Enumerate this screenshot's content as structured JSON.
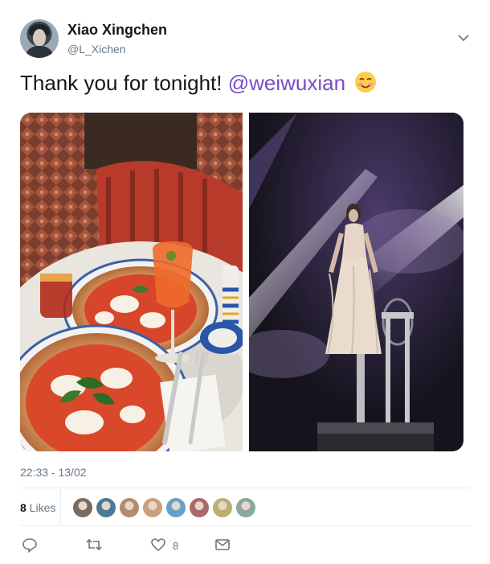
{
  "user": {
    "display_name": "Xiao Xingchen",
    "handle": "@L_Xichen"
  },
  "tweet": {
    "text": "Thank you for tonight! ",
    "mention": "@weiwuxian",
    "emoji": "smiling-face-with-blush",
    "media": [
      {
        "alt": "pizza-and-spritz-photo"
      },
      {
        "alt": "stage-performer-photo"
      }
    ],
    "timestamp": "22:33 - 13/02"
  },
  "likes": {
    "count": "8",
    "label": " Likes",
    "avatar_colors": [
      "#7a6a5f",
      "#4c7a96",
      "#b58a6e",
      "#c9a07a",
      "#6aa0c8",
      "#a86a6a",
      "#b8b070",
      "#88a8a0"
    ]
  },
  "actions": {
    "reply": "reply-icon",
    "retweet": "retweet-icon",
    "like": "heart-icon",
    "like_count": "8",
    "message": "envelope-icon"
  },
  "colors": {
    "mention": "#794bc4",
    "secondary_text": "#657786",
    "divider": "#e6ecf0"
  }
}
